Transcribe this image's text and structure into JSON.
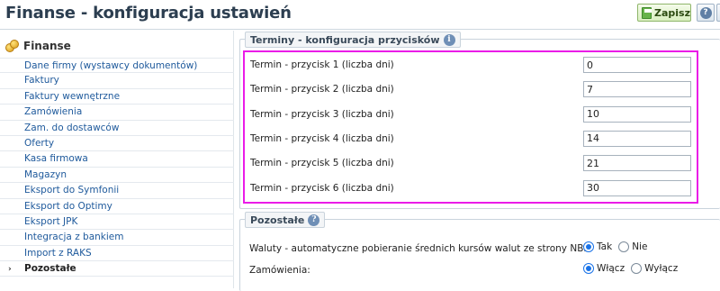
{
  "header": {
    "title": "Finanse - konfiguracja ustawień",
    "save_label": "Zapisz",
    "help_icon": "?"
  },
  "sidebar": {
    "heading": "Finanse",
    "items": [
      {
        "label": "Dane firmy (wystawcy dokumentów)",
        "active": false
      },
      {
        "label": "Faktury",
        "active": false
      },
      {
        "label": "Faktury wewnętrzne",
        "active": false
      },
      {
        "label": "Zamówienia",
        "active": false
      },
      {
        "label": "Zam. do dostawców",
        "active": false
      },
      {
        "label": "Oferty",
        "active": false
      },
      {
        "label": "Kasa firmowa",
        "active": false
      },
      {
        "label": "Magazyn",
        "active": false
      },
      {
        "label": "Eksport do Symfonii",
        "active": false
      },
      {
        "label": "Eksport do Optimy",
        "active": false
      },
      {
        "label": "Eksport JPK",
        "active": false
      },
      {
        "label": "Integracja z bankiem",
        "active": false
      },
      {
        "label": "Import z RAKS",
        "active": false
      },
      {
        "label": "Pozostałe",
        "active": true,
        "chevron": "›"
      }
    ]
  },
  "terms": {
    "legend": "Terminy - konfiguracja przycisków",
    "info_icon": "i",
    "rows": [
      {
        "label": "Termin - przycisk 1 (liczba dni)",
        "value": "0"
      },
      {
        "label": "Termin - przycisk 2 (liczba dni)",
        "value": "7"
      },
      {
        "label": "Termin - przycisk 3 (liczba dni)",
        "value": "10"
      },
      {
        "label": "Termin - przycisk 4 (liczba dni)",
        "value": "14"
      },
      {
        "label": "Termin - przycisk 5 (liczba dni)",
        "value": "21"
      },
      {
        "label": "Termin - przycisk 6 (liczba dni)",
        "value": "30"
      }
    ]
  },
  "other": {
    "legend": "Pozostałe",
    "info_icon": "?",
    "rows": [
      {
        "label": "Waluty - automatyczne pobieranie średnich kursów walut ze strony NBP:",
        "opt1": "Tak",
        "opt2": "Nie",
        "selected": 1
      },
      {
        "label": "Zamówienia:",
        "opt1": "Włącz",
        "opt2": "Wyłącz",
        "selected": 1
      }
    ]
  },
  "colors": {
    "highlight": "#ea1ce8",
    "link": "#1f5a9c",
    "save_green": "#67b34a"
  }
}
